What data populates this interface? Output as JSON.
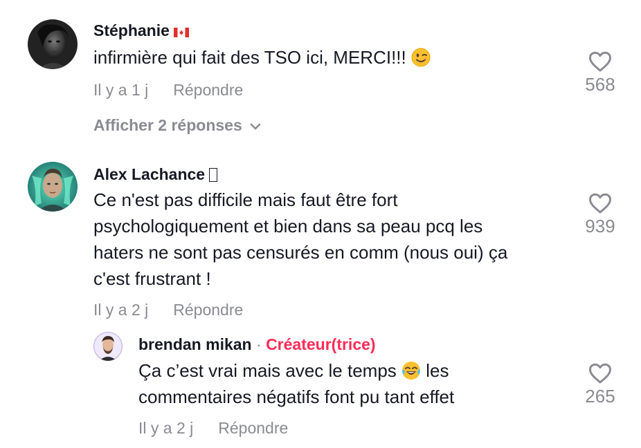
{
  "comments": [
    {
      "author": "Stéphanie",
      "author_badge": "canada-flag-icon",
      "text": "infirmière qui fait des TSO ici, MERCI!!!",
      "text_emoji": "winking-face-icon",
      "time": "Il y a 1 j",
      "reply_label": "Répondre",
      "likes": "568",
      "view_replies_label": "Afficher 2 réponses"
    },
    {
      "author": "Alex Lachance",
      "text_lines": [
        "Ce n'est pas difficile mais faut être fort",
        "psychologiquement et bien dans sa peau pcq les",
        "haters ne sont pas censurés en comm (nous oui) ça",
        "c'est frustrant !"
      ],
      "time": "Il y a 2 j",
      "reply_label": "Répondre",
      "likes": "939",
      "replies": [
        {
          "author": "brendan mikan",
          "separator": "·",
          "creator_label": "Créateur(trice)",
          "text_part1": "Ça c’est vrai mais avec le temps",
          "text_emoji": "face-with-tears-of-joy-icon",
          "text_part2": "les",
          "text_line2": "commentaires négatifs font pu tant effet",
          "time": "Il y a 2 j",
          "reply_label": "Répondre",
          "likes": "265"
        }
      ]
    }
  ],
  "colors": {
    "text": "#161823",
    "muted": "#8a8b91",
    "creator": "#fe2c55"
  }
}
